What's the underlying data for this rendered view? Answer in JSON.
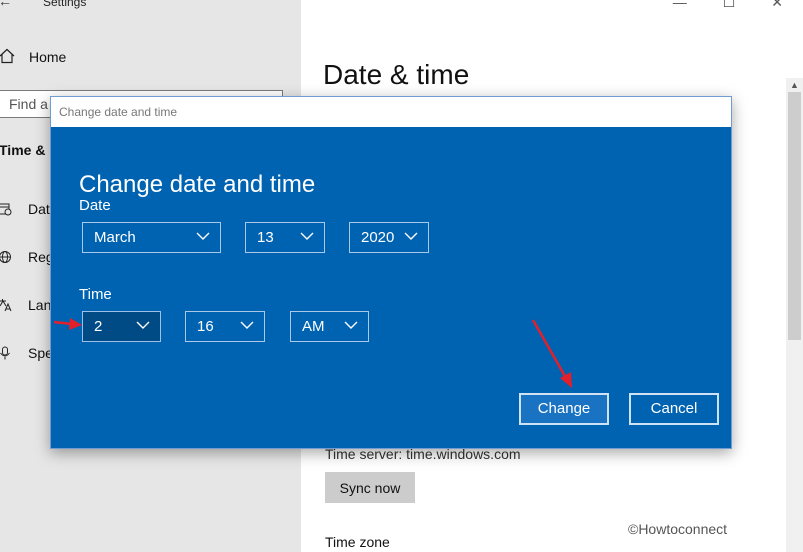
{
  "window": {
    "title": "Settings",
    "controls": [
      "—",
      "☐",
      "✕"
    ]
  },
  "sidebar": {
    "home_label": "Home",
    "find_placeholder": "Find a",
    "section_title": "Time & L",
    "items": [
      {
        "label": "Date",
        "icon": "calendar-clock-icon"
      },
      {
        "label": "Regi",
        "icon": "globe-icon"
      },
      {
        "label": "Lang",
        "icon": "language-icon"
      },
      {
        "label": "Spe",
        "icon": "microphone-icon"
      }
    ]
  },
  "main": {
    "title": "Date & time",
    "time_server": "Time server: time.windows.com",
    "sync_label": "Sync now",
    "time_zone_label": "Time zone"
  },
  "dialog": {
    "titlebar_text": "Change date and time",
    "heading": "Change date and time",
    "date_label": "Date",
    "month": "March",
    "day": "13",
    "year": "2020",
    "time_label": "Time",
    "hour": "2",
    "minute": "16",
    "ampm": "AM",
    "change_label": "Change",
    "cancel_label": "Cancel"
  },
  "watermark": "©Howtoconnect",
  "colors": {
    "dialog_bg": "#0063b1",
    "annotation_arrow": "#e3202a"
  }
}
